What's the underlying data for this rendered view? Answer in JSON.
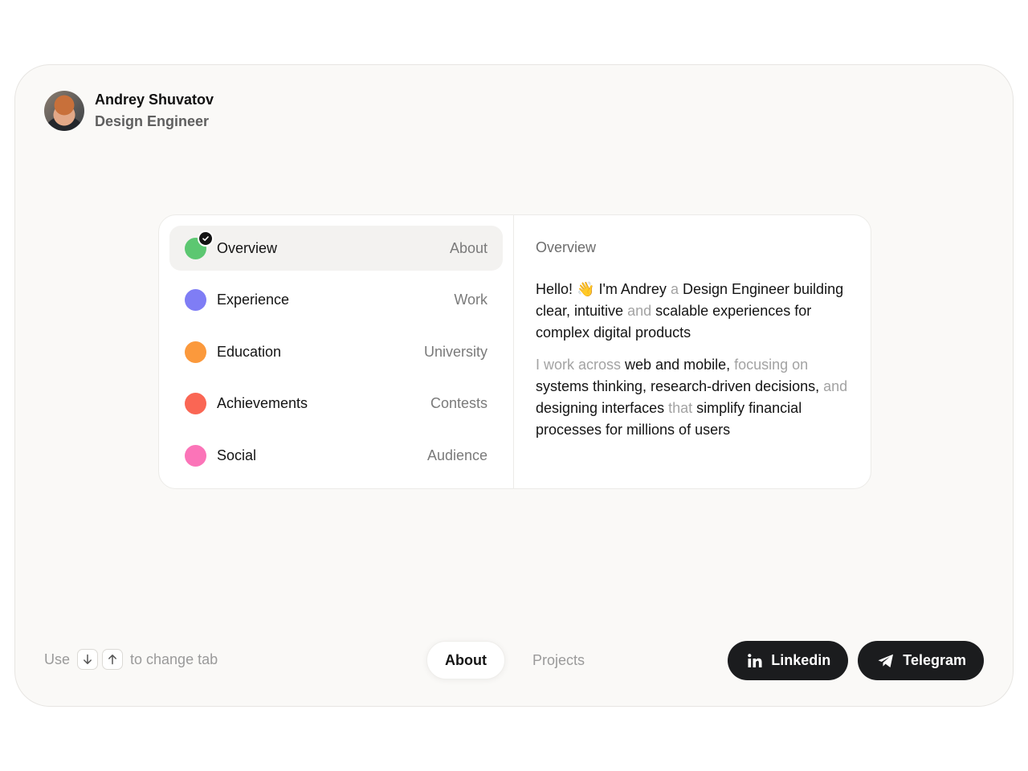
{
  "profile": {
    "name": "Andrey Shuvatov",
    "role": "Design Engineer"
  },
  "menu": {
    "items": [
      {
        "label": "Overview",
        "right": "About",
        "color": "#5cc771",
        "active": true
      },
      {
        "label": "Experience",
        "right": "Work",
        "color": "#7f7df5",
        "active": false
      },
      {
        "label": "Education",
        "right": "University",
        "color": "#fb993c",
        "active": false
      },
      {
        "label": "Achievements",
        "right": "Contests",
        "color": "#fa6654",
        "active": false
      },
      {
        "label": "Social",
        "right": "Audience",
        "color": "#fb74b8",
        "active": false
      }
    ]
  },
  "detail": {
    "title": "Overview",
    "p1": {
      "a": "Hello! ",
      "emoji": "👋",
      "b": " I'm Andrey ",
      "c": "a",
      "d": " Design Engineer building clear, intuitive ",
      "e": "and",
      "f": " scalable experiences for complex digital products"
    },
    "p2": {
      "a": "I work across",
      "b": " web and mobile, ",
      "c": "focusing on",
      "d": " systems thinking, research-driven decisions, ",
      "e": "and",
      "f": " designing interfaces ",
      "g": "that",
      "h": " simplify financial processes for millions of users"
    }
  },
  "hint": {
    "lead": "Use",
    "tail": "to change tab"
  },
  "tabs": {
    "about": "About",
    "projects": "Projects"
  },
  "social": {
    "linkedin": "Linkedin",
    "telegram": "Telegram"
  },
  "colors": {
    "accent_dark": "#1b1c1e",
    "frame_bg": "#faf9f7"
  }
}
